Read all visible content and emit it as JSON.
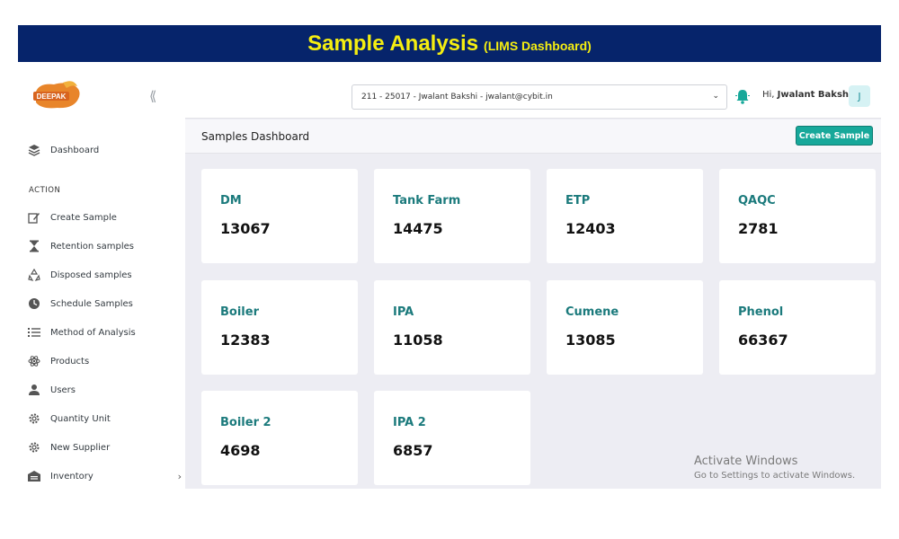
{
  "banner": {
    "title": "Sample Analysis",
    "subtitle": "(LIMS Dashboard)"
  },
  "logo": {
    "text": "DEEPAK",
    "color": "#e8852a"
  },
  "sidebar": {
    "section_label": "ACTION",
    "items": [
      {
        "label": "Dashboard",
        "icon": "layers-icon"
      },
      {
        "label": "Create Sample",
        "icon": "edit-icon"
      },
      {
        "label": "Retention samples",
        "icon": "hourglass-icon"
      },
      {
        "label": "Disposed samples",
        "icon": "recycle-icon"
      },
      {
        "label": "Schedule Samples",
        "icon": "clock-icon"
      },
      {
        "label": "Method of Analysis",
        "icon": "list-icon"
      },
      {
        "label": "Products",
        "icon": "atom-icon"
      },
      {
        "label": "Users",
        "icon": "user-icon"
      },
      {
        "label": "Quantity Unit",
        "icon": "gear-icon"
      },
      {
        "label": "New Supplier",
        "icon": "gear-icon"
      },
      {
        "label": "Inventory",
        "icon": "warehouse-icon"
      }
    ]
  },
  "header": {
    "user_select": "211 - 25017 - Jwalant Bakshi - jwalant@cybit.in",
    "greeting_prefix": "Hi,",
    "user_name": "Jwalant Bakshi",
    "avatar_initial": "J"
  },
  "subheader": {
    "title": "Samples Dashboard",
    "create_button": "Create Sample"
  },
  "cards": [
    {
      "name": "DM",
      "value": "13067"
    },
    {
      "name": "Tank Farm",
      "value": "14475"
    },
    {
      "name": "ETP",
      "value": "12403"
    },
    {
      "name": "QAQC",
      "value": "2781"
    },
    {
      "name": "Boiler",
      "value": "12383"
    },
    {
      "name": "IPA",
      "value": "11058"
    },
    {
      "name": "Cumene",
      "value": "13085"
    },
    {
      "name": "Phenol",
      "value": "66367"
    },
    {
      "name": "Boiler 2",
      "value": "4698"
    },
    {
      "name": "IPA 2",
      "value": "6857"
    }
  ],
  "watermark": {
    "line1": "Activate Windows",
    "line2": "Go to Settings to activate Windows."
  },
  "colors": {
    "banner_bg": "#06246b",
    "banner_text": "#f5ee11",
    "accent": "#17a89a",
    "card_title": "#1b7a7c"
  }
}
